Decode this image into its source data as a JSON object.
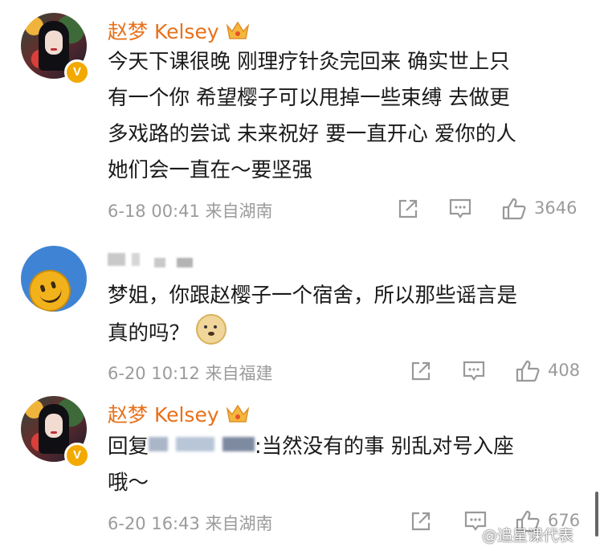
{
  "comments": [
    {
      "username": "赵梦 Kelsey",
      "verified_badge": "V",
      "avatar": "person-avatar",
      "text_lines": [
        "今天下课很晚 刚理疗针灸完回来 确实世上只",
        "有一个你 希望樱子可以甩掉一些束缚 去做更",
        "多戏路的尝试 未来祝好 要一直开心 爱你的人",
        "她们会一直在～要坚强"
      ],
      "timestamp": "6-18 00:41",
      "location": "来自湖南",
      "likes": "3646"
    },
    {
      "username_blurred": true,
      "avatar": "smiley-avatar",
      "text_lines": [
        "梦姐，你跟赵樱子一个宿舍，所以那些谣言是",
        "真的吗？"
      ],
      "emoji": "doge-emoji",
      "timestamp": "6-20 10:12",
      "location": "来自福建",
      "likes": "408"
    },
    {
      "username": "赵梦 Kelsey",
      "verified_badge": "V",
      "avatar": "person-avatar",
      "reply_prefix": "回复",
      "reply_text": ":当然没有的事 别乱对号入座",
      "text_line_2": "哦～",
      "timestamp": "6-20 16:43",
      "location": "来自湖南",
      "likes": "676"
    }
  ],
  "watermark": "@追星课代表",
  "colors": {
    "username": "#e8701a",
    "meta": "#9b9b9b",
    "text": "#1a1a1a",
    "badge": "#f2a900"
  },
  "icons": [
    "crown-icon",
    "share-icon",
    "comment-icon",
    "like-icon"
  ]
}
